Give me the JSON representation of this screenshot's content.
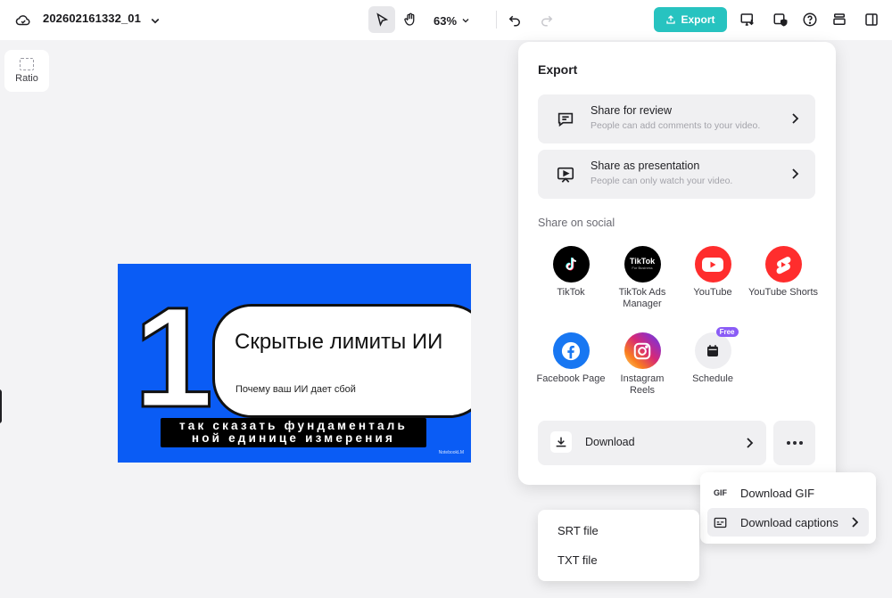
{
  "header": {
    "project_title": "202602161332_01",
    "zoom": "63%",
    "export_label": "Export"
  },
  "ratio": {
    "label": "Ratio"
  },
  "canvas": {
    "number": "1",
    "title": "Скрытые лимиты ИИ",
    "subtitle": "Почему ваш ИИ дает сбой",
    "caption_line1": "так сказать фундаменталь",
    "caption_line2": "ной единице измерения",
    "brand": "NotebookLM",
    "background_color": "#0a5cf5"
  },
  "export_panel": {
    "title": "Export",
    "share_review": {
      "title": "Share for review",
      "subtitle": "People can add comments to your video."
    },
    "share_presentation": {
      "title": "Share as presentation",
      "subtitle": "People can only watch your video."
    },
    "social_label": "Share on social",
    "socials": [
      {
        "label": "TikTok",
        "icon": "tiktok-icon",
        "color": "#000000"
      },
      {
        "label": "TikTok Ads Manager",
        "icon": "tiktok-business-icon",
        "color": "#000000"
      },
      {
        "label": "YouTube",
        "icon": "youtube-icon",
        "color": "#ff2d2d"
      },
      {
        "label": "YouTube Shorts",
        "icon": "youtube-shorts-icon",
        "color": "#ff2d2d"
      },
      {
        "label": "Facebook Page",
        "icon": "facebook-icon",
        "color": "#1877f2"
      },
      {
        "label": "Instagram Reels",
        "icon": "instagram-icon",
        "color": "#d62976"
      },
      {
        "label": "Schedule",
        "icon": "calendar-icon",
        "color": "#eeeef1",
        "badge": "Free"
      }
    ],
    "download_label": "Download",
    "tiktok_business_text": "TikTok",
    "tiktok_business_sub": "For Business"
  },
  "download_menu": {
    "gif_icon": "GIF",
    "gif_label": "Download GIF",
    "captions_label": "Download captions"
  },
  "captions_menu": {
    "srt": "SRT file",
    "txt": "TXT file"
  },
  "colors": {
    "accent": "#27c3c0",
    "panel_bg": "#ffffff",
    "card_bg": "#f0f0f2"
  }
}
